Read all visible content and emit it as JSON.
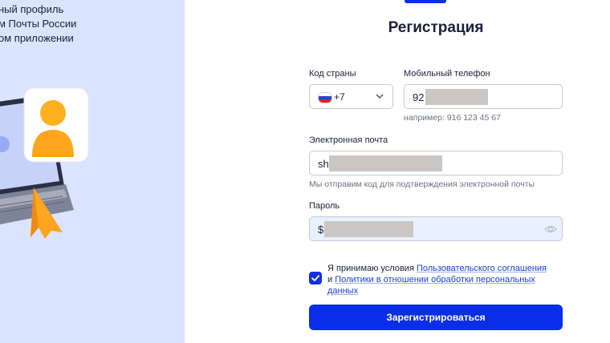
{
  "promo": {
    "line1": "ный профиль",
    "line2": "м Почты России",
    "line3": "ом приложении"
  },
  "form": {
    "title": "Регистрация",
    "country": {
      "label": "Код страны",
      "value": "+7",
      "flag_icon": "russia-flag-icon"
    },
    "phone": {
      "label": "Мобильный телефон",
      "value_visible": "92",
      "hint": "например: 916 123 45 67"
    },
    "email": {
      "label": "Электронная почта",
      "value_visible": "sh",
      "hint": "Мы отправим код для подтверждения электронной почты"
    },
    "password": {
      "label": "Пароль",
      "value_visible": "$",
      "toggle_icon": "eye-icon"
    },
    "consent": {
      "checked": true,
      "prefix": "Я принимаю условия ",
      "link1": "Пользовательского соглашения",
      "conj": " и ",
      "link2": "Политики в отношении обработки персональных данных"
    },
    "submit_label": "Зарегистрироваться"
  },
  "colors": {
    "accent": "#0a2ee8",
    "left_panel": "#dbe4ff",
    "link": "#1840d9",
    "illustration_orange": "#ffa51f"
  }
}
